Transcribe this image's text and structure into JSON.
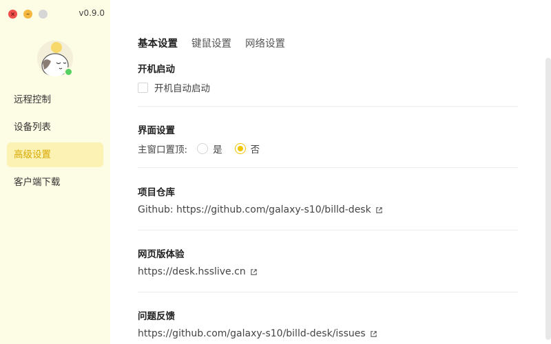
{
  "window": {
    "version": "v0.9.0",
    "close_icon": "close-icon",
    "minimize_icon": "minimize-icon",
    "maximize_icon": "maximize-icon"
  },
  "sidebar": {
    "avatar": "user-avatar",
    "status_color": "#55d163",
    "items": [
      {
        "label": "远程控制"
      },
      {
        "label": "设备列表"
      },
      {
        "label": "高级设置",
        "active": true
      },
      {
        "label": "客户端下载"
      }
    ]
  },
  "tabs": [
    {
      "label": "基本设置",
      "active": true
    },
    {
      "label": "键鼠设置"
    },
    {
      "label": "网络设置"
    }
  ],
  "sections": {
    "startup": {
      "title": "开机启动",
      "checkbox_label": "开机自动启动",
      "checked": false
    },
    "interface": {
      "title": "界面设置",
      "label": "主窗口置顶:",
      "options": [
        {
          "label": "是",
          "selected": false
        },
        {
          "label": "否",
          "selected": true
        }
      ]
    },
    "repo": {
      "title": "项目仓库",
      "text": "Github: https://github.com/galaxy-s10/billd-desk"
    },
    "web": {
      "title": "网页版体验",
      "text": "https://desk.hsslive.cn"
    },
    "feedback": {
      "title": "问题反馈",
      "text": "https://github.com/galaxy-s10/billd-desk/issues"
    }
  },
  "colors": {
    "accent": "#f0c400",
    "sidebar_bg": "#fdfce4",
    "active_bg": "#fbf2b4",
    "active_text": "#d9a800"
  }
}
